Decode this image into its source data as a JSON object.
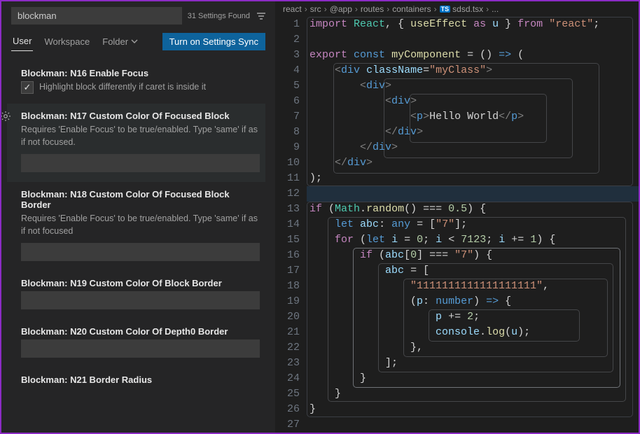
{
  "settings": {
    "search_value": "blockman",
    "found_text": "31 Settings Found",
    "tabs": {
      "user": "User",
      "workspace": "Workspace",
      "folder": "Folder"
    },
    "sync_button": "Turn on Settings Sync",
    "items": [
      {
        "prefix": "Blockman:",
        "name": "N16 Enable Focus",
        "desc": "Highlight block differently if caret is inside it",
        "type": "checkbox",
        "checked": true
      },
      {
        "prefix": "Blockman:",
        "name": "N17 Custom Color Of Focused Block",
        "desc": "Requires 'Enable Focus' to be true/enabled. Type 'same' if as if not focused.",
        "type": "text",
        "value": "",
        "focused": true
      },
      {
        "prefix": "Blockman:",
        "name": "N18 Custom Color Of Focused Block Border",
        "desc": "Requires 'Enable Focus' to be true/enabled. Type 'same' if as if not focused",
        "type": "text",
        "value": ""
      },
      {
        "prefix": "Blockman:",
        "name": "N19 Custom Color Of Block Border",
        "desc": "",
        "type": "text",
        "value": ""
      },
      {
        "prefix": "Blockman:",
        "name": "N20 Custom Color Of Depth0 Border",
        "desc": "",
        "type": "text",
        "value": ""
      },
      {
        "prefix": "Blockman:",
        "name": "N21 Border Radius",
        "desc": "",
        "type": "none"
      }
    ]
  },
  "breadcrumbs": {
    "parts": [
      "react",
      "src",
      "@app",
      "routes",
      "containers"
    ],
    "file": "sdsd.tsx",
    "ts_badge": "TS",
    "trail": "..."
  },
  "code": {
    "line_count": 27,
    "lines": [
      [
        [
          "kw",
          "import"
        ],
        [
          "txt",
          " "
        ],
        [
          "cls",
          "React"
        ],
        [
          "txt",
          ", { "
        ],
        [
          "fn",
          "useEffect"
        ],
        [
          "txt",
          " "
        ],
        [
          "kw",
          "as"
        ],
        [
          "txt",
          " "
        ],
        [
          "id",
          "u"
        ],
        [
          "txt",
          " } "
        ],
        [
          "kw",
          "from"
        ],
        [
          "txt",
          " "
        ],
        [
          "str",
          "\"react\""
        ],
        [
          "txt",
          ";"
        ]
      ],
      [],
      [
        [
          "kw",
          "export"
        ],
        [
          "txt",
          " "
        ],
        [
          "kw2",
          "const"
        ],
        [
          "txt",
          " "
        ],
        [
          "fn",
          "myComponent"
        ],
        [
          "txt",
          " "
        ],
        [
          "op",
          "="
        ],
        [
          "txt",
          " () "
        ],
        [
          "kw2",
          "=>"
        ],
        [
          "txt",
          " ("
        ]
      ],
      [
        [
          "txt",
          "    "
        ],
        [
          "tagp",
          "<"
        ],
        [
          "tag",
          "div"
        ],
        [
          "txt",
          " "
        ],
        [
          "attr",
          "className"
        ],
        [
          "op",
          "="
        ],
        [
          "str",
          "\"myClass\""
        ],
        [
          "tagp",
          ">"
        ]
      ],
      [
        [
          "txt",
          "        "
        ],
        [
          "tagp",
          "<"
        ],
        [
          "tag",
          "div"
        ],
        [
          "tagp",
          ">"
        ]
      ],
      [
        [
          "txt",
          "            "
        ],
        [
          "tagp",
          "<"
        ],
        [
          "tag",
          "div"
        ],
        [
          "tagp",
          ">"
        ]
      ],
      [
        [
          "txt",
          "                "
        ],
        [
          "tagp",
          "<"
        ],
        [
          "tag",
          "p"
        ],
        [
          "tagp",
          ">"
        ],
        [
          "txt",
          "Hello World"
        ],
        [
          "tagp",
          "</"
        ],
        [
          "tag",
          "p"
        ],
        [
          "tagp",
          ">"
        ]
      ],
      [
        [
          "txt",
          "            "
        ],
        [
          "tagp",
          "</"
        ],
        [
          "tag",
          "div"
        ],
        [
          "tagp",
          ">"
        ]
      ],
      [
        [
          "txt",
          "        "
        ],
        [
          "tagp",
          "</"
        ],
        [
          "tag",
          "div"
        ],
        [
          "tagp",
          ">"
        ]
      ],
      [
        [
          "txt",
          "    "
        ],
        [
          "tagp",
          "</"
        ],
        [
          "tag",
          "div"
        ],
        [
          "tagp",
          ">"
        ]
      ],
      [
        [
          "txt",
          ");"
        ]
      ],
      [],
      [
        [
          "kw",
          "if"
        ],
        [
          "txt",
          " ("
        ],
        [
          "cls",
          "Math"
        ],
        [
          "txt",
          "."
        ],
        [
          "fn",
          "random"
        ],
        [
          "txt",
          "() "
        ],
        [
          "op",
          "==="
        ],
        [
          "txt",
          " "
        ],
        [
          "num",
          "0.5"
        ],
        [
          "txt",
          ") {"
        ]
      ],
      [
        [
          "txt",
          "    "
        ],
        [
          "kw2",
          "let"
        ],
        [
          "txt",
          " "
        ],
        [
          "id",
          "abc"
        ],
        [
          "txt",
          ": "
        ],
        [
          "kw2",
          "any"
        ],
        [
          "txt",
          " "
        ],
        [
          "op",
          "="
        ],
        [
          "txt",
          " ["
        ],
        [
          "str",
          "\"7\""
        ],
        [
          "txt",
          "];"
        ]
      ],
      [
        [
          "txt",
          "    "
        ],
        [
          "kw",
          "for"
        ],
        [
          "txt",
          " ("
        ],
        [
          "kw2",
          "let"
        ],
        [
          "txt",
          " "
        ],
        [
          "id",
          "i"
        ],
        [
          "txt",
          " "
        ],
        [
          "op",
          "="
        ],
        [
          "txt",
          " "
        ],
        [
          "num",
          "0"
        ],
        [
          "txt",
          "; "
        ],
        [
          "id",
          "i"
        ],
        [
          "txt",
          " "
        ],
        [
          "op",
          "<"
        ],
        [
          "txt",
          " "
        ],
        [
          "num",
          "7123"
        ],
        [
          "txt",
          "; "
        ],
        [
          "id",
          "i"
        ],
        [
          "txt",
          " "
        ],
        [
          "op",
          "+="
        ],
        [
          "txt",
          " "
        ],
        [
          "num",
          "1"
        ],
        [
          "txt",
          ") {"
        ]
      ],
      [
        [
          "txt",
          "        "
        ],
        [
          "kw",
          "if"
        ],
        [
          "txt",
          " ("
        ],
        [
          "id",
          "abc"
        ],
        [
          "txt",
          "["
        ],
        [
          "num",
          "0"
        ],
        [
          "txt",
          "] "
        ],
        [
          "op",
          "==="
        ],
        [
          "txt",
          " "
        ],
        [
          "str",
          "\"7\""
        ],
        [
          "txt",
          ") {"
        ]
      ],
      [
        [
          "txt",
          "            "
        ],
        [
          "id",
          "abc"
        ],
        [
          "txt",
          " "
        ],
        [
          "op",
          "="
        ],
        [
          "txt",
          " ["
        ]
      ],
      [
        [
          "txt",
          "                "
        ],
        [
          "str",
          "\"1111111111111111111\""
        ],
        [
          "txt",
          ","
        ]
      ],
      [
        [
          "txt",
          "                ("
        ],
        [
          "id",
          "p"
        ],
        [
          "txt",
          ": "
        ],
        [
          "kw2",
          "number"
        ],
        [
          "txt",
          ") "
        ],
        [
          "kw2",
          "=>"
        ],
        [
          "txt",
          " {"
        ]
      ],
      [
        [
          "txt",
          "                    "
        ],
        [
          "id",
          "p"
        ],
        [
          "txt",
          " "
        ],
        [
          "op",
          "+="
        ],
        [
          "txt",
          " "
        ],
        [
          "num",
          "2"
        ],
        [
          "txt",
          ";"
        ]
      ],
      [
        [
          "txt",
          "                    "
        ],
        [
          "id",
          "console"
        ],
        [
          "txt",
          "."
        ],
        [
          "fn",
          "log"
        ],
        [
          "txt",
          "("
        ],
        [
          "id",
          "u"
        ],
        [
          "txt",
          ");"
        ]
      ],
      [
        [
          "txt",
          "                },"
        ]
      ],
      [
        [
          "txt",
          "            ];"
        ]
      ],
      [
        [
          "txt",
          "        }"
        ]
      ],
      [
        [
          "txt",
          "    }"
        ]
      ],
      [
        [
          "txt",
          "}"
        ]
      ],
      []
    ]
  }
}
